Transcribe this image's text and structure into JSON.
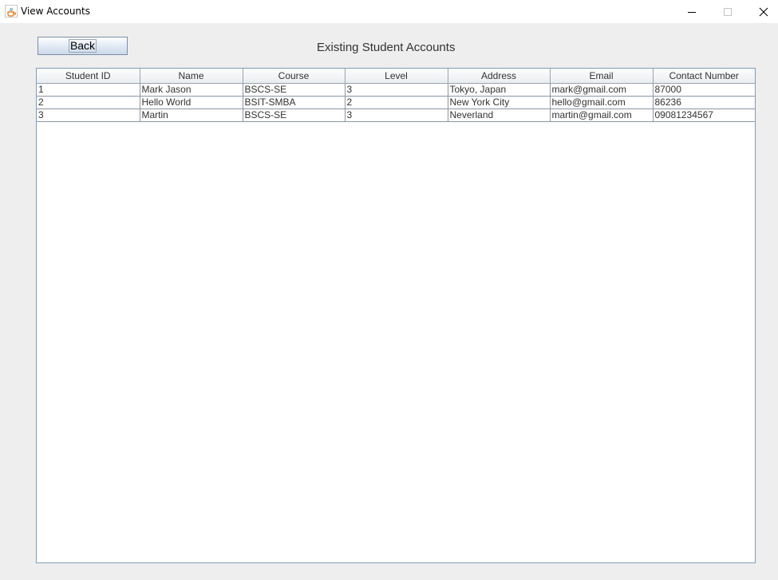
{
  "window": {
    "title": "View Accounts",
    "icon": "java-cup-icon",
    "controls": [
      "minimize-icon",
      "maximize-icon",
      "close-icon"
    ]
  },
  "toolbar": {
    "back_label": "Back"
  },
  "page": {
    "title": "Existing Student Accounts"
  },
  "table": {
    "columns": [
      "Student ID",
      "Name",
      "Course",
      "Level",
      "Address",
      "Email",
      "Contact Number"
    ],
    "rows": [
      [
        "1",
        "Mark Jason",
        "BSCS-SE",
        "3",
        "Tokyo, Japan",
        "mark@gmail.com",
        "87000"
      ],
      [
        "2",
        "Hello World",
        "BSIT-SMBA",
        "2",
        "New York City",
        "hello@gmail.com",
        "86236"
      ],
      [
        "3",
        "Martin",
        "BSCS-SE",
        "3",
        "Neverland",
        "martin@gmail.com",
        "09081234567"
      ]
    ]
  },
  "colors": {
    "window_bg": "#eeeeee",
    "table_border": "#7f9db9",
    "text": "#333333"
  }
}
